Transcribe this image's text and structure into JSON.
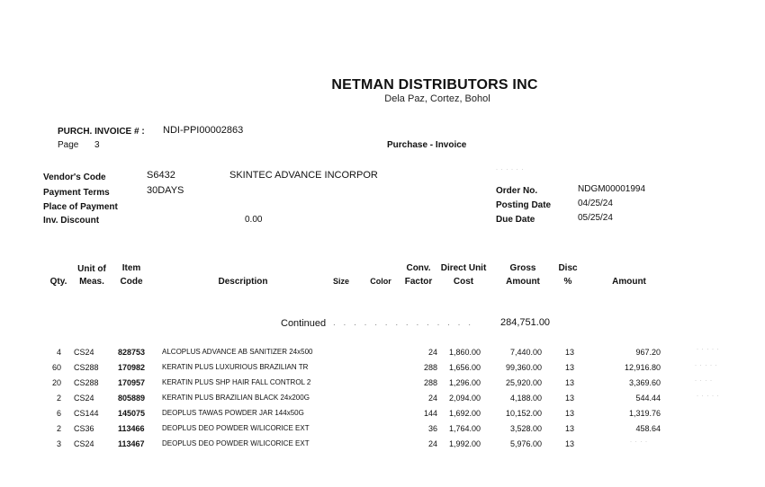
{
  "header": {
    "company": "NETMAN DISTRIBUTORS INC",
    "address": "Dela Paz, Cortez, Bohol",
    "invoice_label": "PURCH. INVOICE # :",
    "invoice_number": "NDI-PPI00002863",
    "page_label": "Page",
    "page_number": "3",
    "doc_type": "Purchase - Invoice"
  },
  "vendor": {
    "code_label": "Vendor's Code",
    "code": "S6432",
    "name": "SKINTEC ADVANCE INCORPOR",
    "terms_label": "Payment Terms",
    "terms": "30DAYS",
    "place_label": "Place of Payment",
    "discount_label": "Inv. Discount",
    "discount": "0.00"
  },
  "order": {
    "order_label": "Order No.",
    "order_no": "NDGM00001994",
    "posting_label": "Posting Date",
    "posting_date": "04/25/24",
    "due_label": "Due Date",
    "due_date": "05/25/24"
  },
  "columns": {
    "qty": "Qty.",
    "uom_1": "Unit of",
    "uom_2": "Meas.",
    "item_1": "Item",
    "item_2": "Code",
    "description": "Description",
    "size": "Size",
    "color": "Color",
    "conv_1": "Conv.",
    "conv_2": "Factor",
    "cost_1": "Direct Unit",
    "cost_2": "Cost",
    "gross_1": "Gross",
    "gross_2": "Amount",
    "disc_1": "Disc",
    "disc_2": "%",
    "amount": "Amount"
  },
  "continued": {
    "label": "Continued",
    "amount": "284,751.00"
  },
  "items": [
    {
      "qty": "4",
      "uom": "CS24",
      "code": "828753",
      "desc": "ALCOPLUS ADVANCE AB SANITIZER 24x500",
      "conv": "24",
      "cost": "1,860.00",
      "gross": "7,440.00",
      "disc": "13",
      "amount": "967.20"
    },
    {
      "qty": "60",
      "uom": "CS288",
      "code": "170982",
      "desc": "KERATIN PLUS LUXURIOUS BRAZILIAN TR",
      "conv": "288",
      "cost": "1,656.00",
      "gross": "99,360.00",
      "disc": "13",
      "amount": "12,916.80"
    },
    {
      "qty": "20",
      "uom": "CS288",
      "code": "170957",
      "desc": "KERATIN PLUS SHP HAIR FALL CONTROL 2",
      "conv": "288",
      "cost": "1,296.00",
      "gross": "25,920.00",
      "disc": "13",
      "amount": "3,369.60"
    },
    {
      "qty": "2",
      "uom": "CS24",
      "code": "805889",
      "desc": "KERATIN PLUS BRAZILIAN BLACK 24x200G",
      "conv": "24",
      "cost": "2,094.00",
      "gross": "4,188.00",
      "disc": "13",
      "amount": "544.44"
    },
    {
      "qty": "6",
      "uom": "CS144",
      "code": "145075",
      "desc": "DEOPLUS TAWAS POWDER JAR 144x50G",
      "conv": "144",
      "cost": "1,692.00",
      "gross": "10,152.00",
      "disc": "13",
      "amount": "1,319.76"
    },
    {
      "qty": "2",
      "uom": "CS36",
      "code": "113466",
      "desc": "DEOPLUS DEO POWDER W/LICORICE EXT",
      "conv": "36",
      "cost": "1,764.00",
      "gross": "3,528.00",
      "disc": "13",
      "amount": "458.64"
    },
    {
      "qty": "3",
      "uom": "CS24",
      "code": "113467",
      "desc": "DEOPLUS DEO POWDER W/LICORICE EXT",
      "conv": "24",
      "cost": "1,992.00",
      "gross": "5,976.00",
      "disc": "13",
      "amount": ""
    }
  ]
}
